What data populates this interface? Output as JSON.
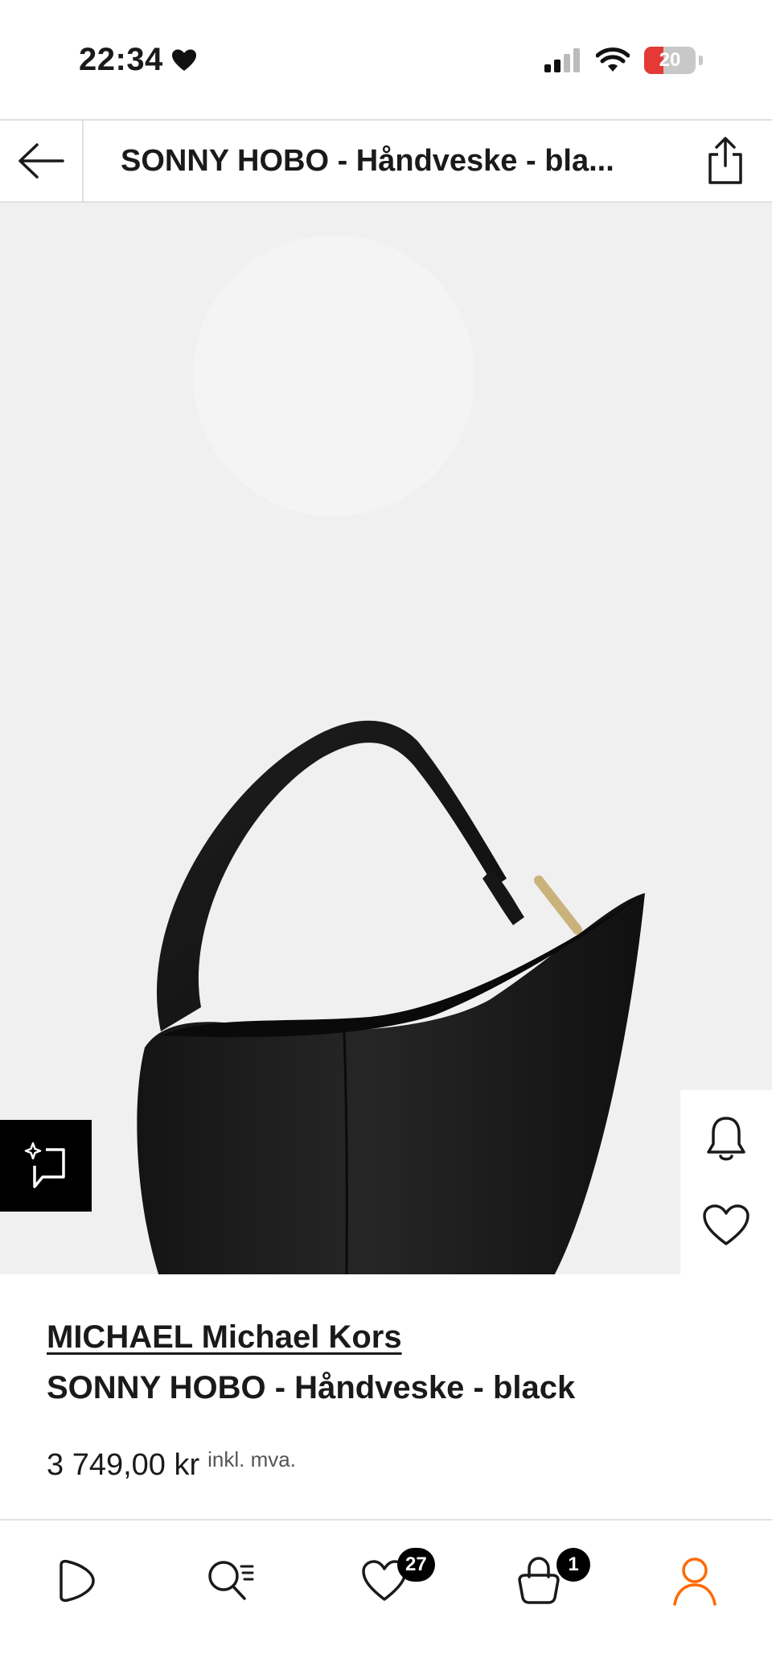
{
  "status_bar": {
    "time": "22:34",
    "battery_level": "20"
  },
  "header": {
    "title": "SONNY HOBO  - Håndveske - bla..."
  },
  "product": {
    "brand": "MICHAEL Michael Kors",
    "name": "SONNY HOBO  - Håndveske - black",
    "price": "3 749,00 kr",
    "price_note": "inkl. mva.",
    "image_count_active": 1
  },
  "bottom_nav": {
    "wishlist_count": "27",
    "bag_count": "1",
    "accent_color": "#ff6900"
  },
  "icons": [
    "arrow-left-icon",
    "share-icon",
    "ai-sparkle-icon",
    "bell-icon",
    "heart-icon",
    "play-icon",
    "search-icon",
    "wishlist-icon",
    "bag-icon",
    "profile-icon"
  ]
}
